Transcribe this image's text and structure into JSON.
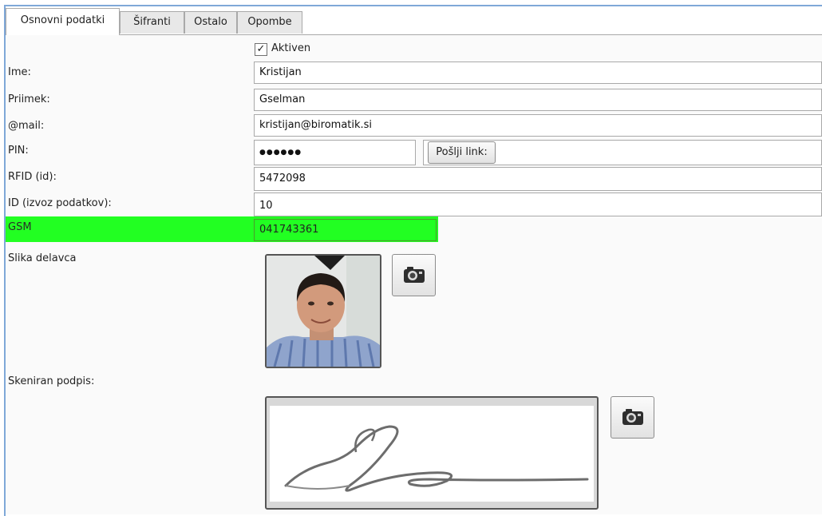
{
  "tabs": [
    {
      "label": "Osnovni podatki",
      "active": true
    },
    {
      "label": "Šifranti"
    },
    {
      "label": "Ostalo"
    },
    {
      "label": "Opombe"
    }
  ],
  "form": {
    "active_checkbox": {
      "label": "Aktiven",
      "checked": true,
      "mark": "✓"
    },
    "fields": {
      "ime": {
        "label": "Ime:",
        "value": "Kristijan"
      },
      "priimek": {
        "label": "Priimek:",
        "value": "Gselman"
      },
      "email": {
        "label": "@mail:",
        "value": "kristijan@biromatik.si"
      },
      "pin": {
        "label": "PIN:",
        "value": "●●●●●●"
      },
      "rfid": {
        "label": "RFID (id):",
        "value": "5472098"
      },
      "export_id": {
        "label": "ID (izvoz podatkov):",
        "value": "10"
      },
      "gsm": {
        "label": "GSM",
        "value": "041743361",
        "highlight_color": "#22ff22"
      }
    },
    "send_link_button": "Pošlji link:",
    "photo_label": "Slika delavca",
    "signature_label": "Skeniran podpis:",
    "camera_icon": "camera-icon"
  }
}
